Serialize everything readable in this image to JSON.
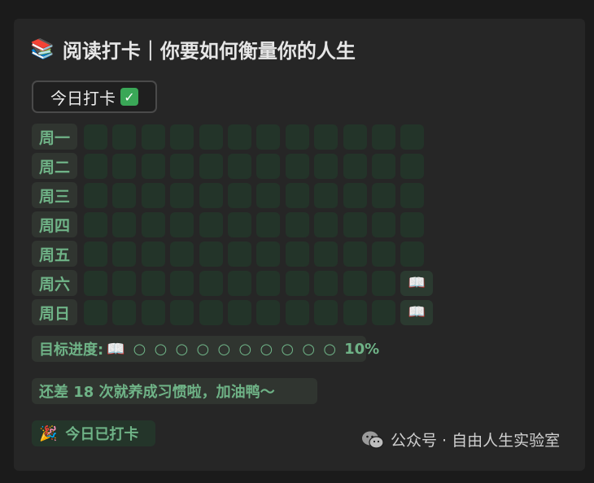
{
  "header": {
    "emoji": "📚",
    "title": "阅读打卡｜你要如何衡量你的人生"
  },
  "checkin_button": {
    "label": "今日打卡",
    "icon": "✅"
  },
  "days": [
    "周一",
    "周二",
    "周三",
    "周四",
    "周五",
    "周六",
    "周日"
  ],
  "grid": {
    "columns": 12,
    "read_icon": "📖",
    "read_marks": [
      {
        "day": 5,
        "col": 11
      },
      {
        "day": 6,
        "col": 11
      }
    ]
  },
  "progress": {
    "label": "目标进度:",
    "icon": "📖",
    "dots": "○ ○ ○ ○ ○ ○ ○ ○ ○ ○",
    "percent": "10%",
    "value": 0.1
  },
  "remain": {
    "text": "还差 18 次就养成习惯啦，加油鸭～"
  },
  "done": {
    "emoji": "🎉",
    "text": "今日已打卡"
  },
  "watermark": {
    "text": "公众号 · 自由人生实验室"
  },
  "colors": {
    "accent_green": "#6fb387",
    "cell_bg": "#233429",
    "card_bg": "#262626"
  }
}
